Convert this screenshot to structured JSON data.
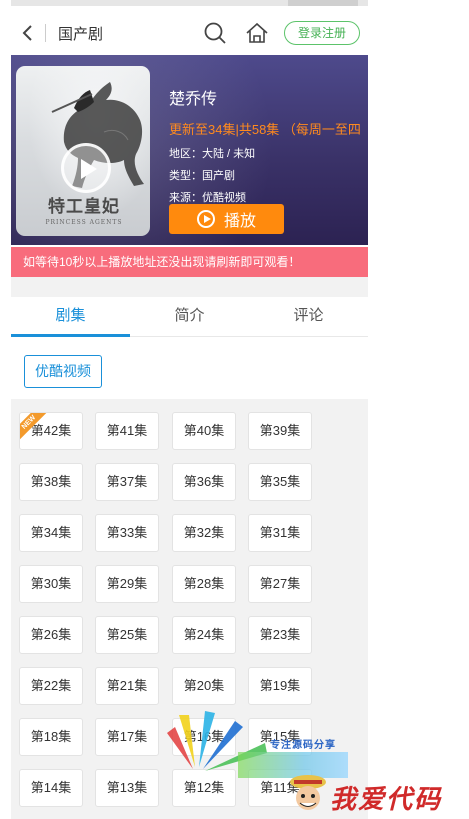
{
  "header": {
    "title": "国产剧",
    "login_label": "登录注册"
  },
  "show": {
    "name": "楚乔传",
    "update": "更新至34集|共58集 （每周一至四",
    "region": "地区：大陆 / 未知",
    "type": "类型：国产剧",
    "source": "来源：优酷视频",
    "play_label": "播放",
    "poster_title": "特工皇妃",
    "poster_subtitle": "楚乔传",
    "poster_en": "PRINCESS AGENTS"
  },
  "notice": "如等待10秒以上播放地址还没出现请刷新即可观看！",
  "tabs": [
    "剧集",
    "简介",
    "评论"
  ],
  "source_button": "优酷视频",
  "new_badge": "NEW",
  "episodes": [
    [
      "第42集",
      "第41集",
      "第40集",
      "第39集"
    ],
    [
      "第38集",
      "第37集",
      "第36集",
      "第35集"
    ],
    [
      "第34集",
      "第33集",
      "第32集",
      "第31集"
    ],
    [
      "第30集",
      "第29集",
      "第28集",
      "第27集"
    ],
    [
      "第26集",
      "第25集",
      "第24集",
      "第23集"
    ],
    [
      "第22集",
      "第21集",
      "第20集",
      "第19集"
    ],
    [
      "第18集",
      "第17集",
      "第16集",
      "第15集"
    ],
    [
      "第14集",
      "第13集",
      "第12集",
      "第11集"
    ]
  ],
  "watermark": {
    "tagline": "专注源码分享",
    "brand": "我爱代码"
  },
  "colors": {
    "accent_blue": "#1a90d9",
    "play_orange": "#ff8a0d",
    "notice_pink": "#f86c7c",
    "login_green": "#45b154"
  }
}
